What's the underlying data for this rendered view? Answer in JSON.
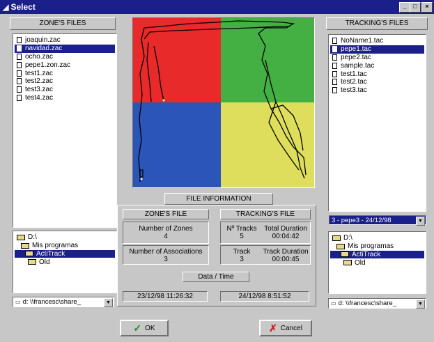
{
  "window": {
    "title": "Select",
    "controls": [
      "_",
      "□",
      "×"
    ]
  },
  "zones_panel": {
    "title": "ZONE'S FILES",
    "files": [
      {
        "name": "joaquin.zac",
        "selected": false
      },
      {
        "name": "navidad.zac",
        "selected": true
      },
      {
        "name": "ocho.zac",
        "selected": false
      },
      {
        "name": "pepe1.zon.zac",
        "selected": false
      },
      {
        "name": "test1.zac",
        "selected": false
      },
      {
        "name": "test2.zac",
        "selected": false
      },
      {
        "name": "test3.zac",
        "selected": false
      },
      {
        "name": "test4.zac",
        "selected": false
      }
    ],
    "folders": [
      {
        "name": "D:\\",
        "selected": false
      },
      {
        "name": "Mis programas",
        "selected": false
      },
      {
        "name": "ActiTrack",
        "selected": true
      },
      {
        "name": "Old",
        "selected": false
      }
    ],
    "drive": "d: \\\\francesc\\share_"
  },
  "tracking_panel": {
    "title": "TRACKING'S FILES",
    "files": [
      {
        "name": "NoName1.tac",
        "selected": false
      },
      {
        "name": "pepe1.tac",
        "selected": true
      },
      {
        "name": "pepe2.tac",
        "selected": false
      },
      {
        "name": "sample.tac",
        "selected": false
      },
      {
        "name": "test1.tac",
        "selected": false
      },
      {
        "name": "test2.tac",
        "selected": false
      },
      {
        "name": "test3.tac",
        "selected": false
      }
    ],
    "track_select": "3 - pepe3 - 24/12/98",
    "folders": [
      {
        "name": "D:\\",
        "selected": false
      },
      {
        "name": "Mis programas",
        "selected": false
      },
      {
        "name": "ActiTrack",
        "selected": true
      },
      {
        "name": "Old",
        "selected": false
      }
    ],
    "drive": "d: \\\\francesc\\share_"
  },
  "zone_map": {
    "colors": {
      "top_left": "#e82a2a",
      "top_right": "#44b044",
      "bottom_left": "#2b55b8",
      "bottom_right": "#dede5c"
    }
  },
  "file_info": {
    "title": "FILE INFORMATION",
    "zone_file_label": "ZONE'S FILE",
    "tracking_file_label": "TRACKING'S FILE",
    "num_zones_label": "Number of Zones",
    "num_zones": "4",
    "num_assoc_label": "Number of Associations",
    "num_assoc": "3",
    "n_tracks_label": "Nº Tracks",
    "n_tracks": "5",
    "total_duration_label": "Total Duration",
    "total_duration": "00:04:42",
    "track_label": "Track",
    "track": "3",
    "track_duration_label": "Track Duration",
    "track_duration": "00:00:45",
    "datetime_label": "Data / Time",
    "zone_datetime": "23/12/98 11:26:32",
    "tracking_datetime": "24/12/98 8:51:52"
  },
  "buttons": {
    "ok": "OK",
    "cancel": "Cancel"
  }
}
